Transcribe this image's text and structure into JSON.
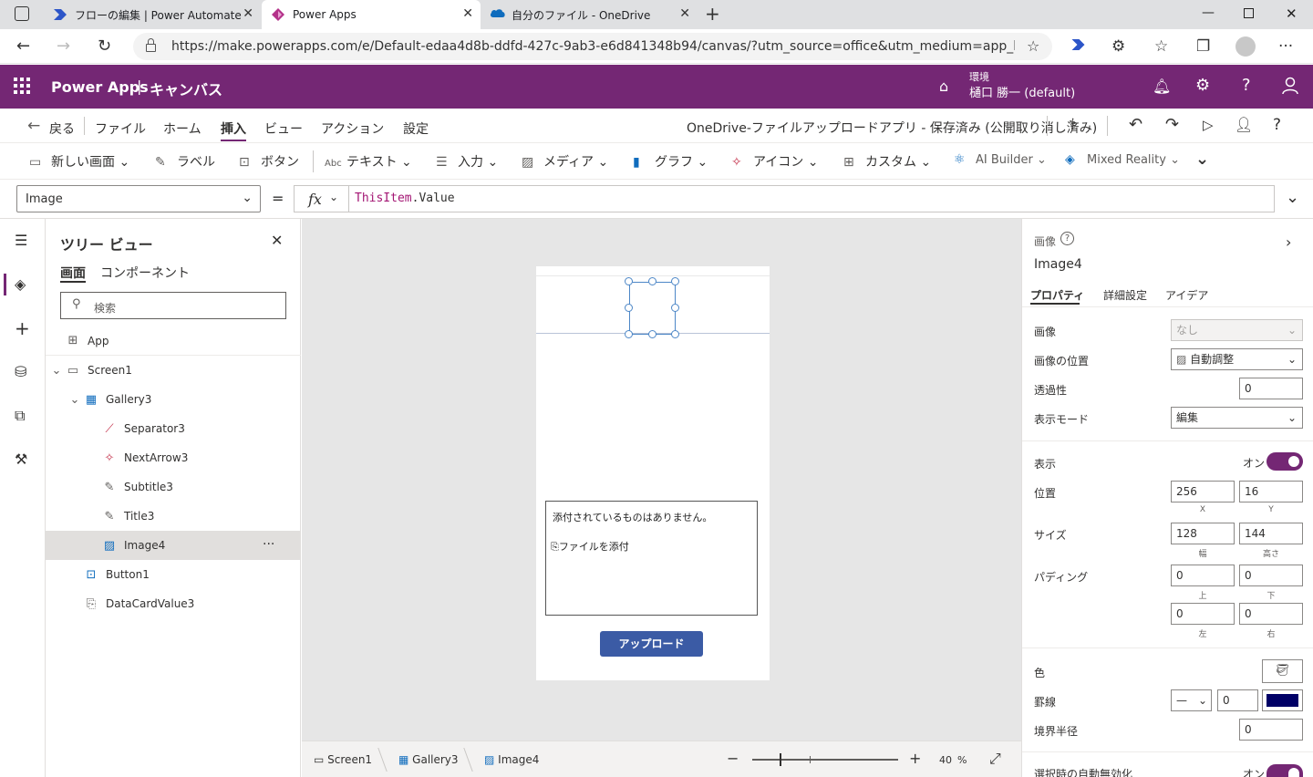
{
  "browser": {
    "tabs": [
      {
        "title": "フローの編集 | Power Automate",
        "active": false
      },
      {
        "title": "Power Apps",
        "active": true
      },
      {
        "title": "自分のファイル - OneDrive",
        "active": false
      }
    ],
    "new_tab": "+",
    "url": "https://make.powerapps.com/e/Default-edaa4d8b-ddfd-427c-9ab3-e6d841348b94/canvas/?utm_source=office&utm_medium=app_launcher&utm_..."
  },
  "header": {
    "app_name": "Power Apps",
    "separator": "|",
    "section": "キャンバス",
    "env_label": "環境",
    "env_name": "樋口 勝一 (default)"
  },
  "command": {
    "back": "戻る",
    "menus": [
      "ファイル",
      "ホーム",
      "挿入",
      "ビュー",
      "アクション",
      "設定"
    ],
    "active_menu": "挿入",
    "doc_title": "OneDrive-ファイルアップロードアプリ - 保存済み (公開取り消し済み)"
  },
  "insert": {
    "items": [
      "新しい画面",
      "ラベル",
      "ボタン",
      "テキスト",
      "入力",
      "メディア",
      "グラフ",
      "アイコン",
      "カスタム",
      "AI Builder",
      "Mixed Reality"
    ]
  },
  "formula": {
    "property": "Image",
    "equals": "=",
    "fx": "fx",
    "expr_obj": "ThisItem",
    "expr_rest": ".Value"
  },
  "tree": {
    "title": "ツリー ビュー",
    "tabs": [
      "画面",
      "コンポーネント"
    ],
    "search_placeholder": "検索",
    "items": [
      "App",
      "Screen1",
      "Gallery3",
      "Separator3",
      "NextArrow3",
      "Subtitle3",
      "Title3",
      "Image4",
      "Button1",
      "DataCardValue3"
    ],
    "more": "···"
  },
  "canvas": {
    "attach_empty": "添付されているものはありません。",
    "attach_link": "ファイルを添付",
    "upload_button": "アップロード"
  },
  "status": {
    "crumbs": [
      "Screen1",
      "Gallery3",
      "Image4"
    ],
    "zoom": "40",
    "zoom_unit": "%"
  },
  "props": {
    "type_label": "画像",
    "control_name": "Image4",
    "tabs": [
      "プロパティ",
      "詳細設定",
      "アイデア"
    ],
    "image_label": "画像",
    "image_value": "なし",
    "image_pos_label": "画像の位置",
    "image_pos_value": "自動調整",
    "transparency_label": "透過性",
    "transparency_value": "0",
    "display_mode_label": "表示モード",
    "display_mode_value": "編集",
    "visible_label": "表示",
    "visible_value": "オン",
    "position_label": "位置",
    "x_value": "256",
    "y_value": "16",
    "x_sub": "X",
    "y_sub": "Y",
    "size_label": "サイズ",
    "w_value": "128",
    "h_value": "144",
    "w_sub": "幅",
    "h_sub": "高さ",
    "padding_label": "パディング",
    "pad_top": "0",
    "pad_bottom": "0",
    "pad_left": "0",
    "pad_right": "0",
    "pad_top_sub": "上",
    "pad_bottom_sub": "下",
    "pad_left_sub": "左",
    "pad_right_sub": "右",
    "color_label": "色",
    "border_label": "罫線",
    "border_value": "0",
    "border_color": "#000066",
    "radius_label": "境界半径",
    "radius_value": "0",
    "auto_disable_label": "選択時の自動無効化",
    "auto_disable_value": "オン"
  },
  "colors": {
    "brand": "#742774",
    "accent": "#3b5ba5",
    "toggle": "#742774"
  }
}
